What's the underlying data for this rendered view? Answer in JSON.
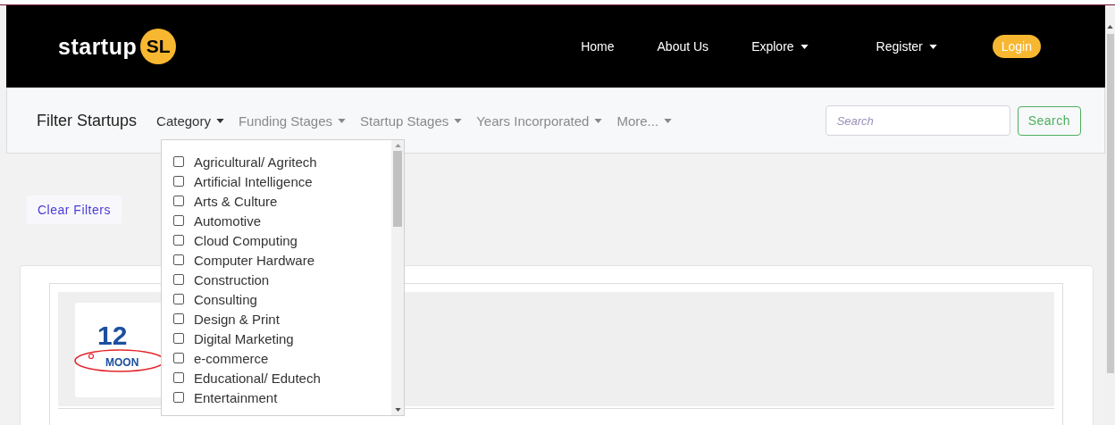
{
  "navbar": {
    "logo": {
      "text": "startup",
      "mark": "SL"
    },
    "items": [
      {
        "label": "Home",
        "kind": "link"
      },
      {
        "label": "About Us",
        "kind": "link"
      },
      {
        "label": "Explore",
        "kind": "dropdown"
      },
      {
        "label": "Register",
        "kind": "dropdown"
      },
      {
        "label": "Login",
        "kind": "button"
      }
    ]
  },
  "filter_bar": {
    "title": "Filter Startups",
    "menus": [
      {
        "label": "Category",
        "selected": true
      },
      {
        "label": "Funding Stages",
        "selected": false
      },
      {
        "label": "Startup Stages",
        "selected": false
      },
      {
        "label": "Years Incorporated",
        "selected": false
      },
      {
        "label": "More...",
        "selected": false
      }
    ],
    "search": {
      "placeholder": "Search"
    },
    "search_button": "Search"
  },
  "category_menu": {
    "items": [
      {
        "label": "Agricultural/ Agritech",
        "checked": false
      },
      {
        "label": "Artificial Intelligence",
        "checked": false
      },
      {
        "label": "Arts & Culture",
        "checked": false
      },
      {
        "label": "Automotive",
        "checked": false
      },
      {
        "label": "Cloud Computing",
        "checked": false
      },
      {
        "label": "Computer Hardware",
        "checked": false
      },
      {
        "label": "Construction",
        "checked": false
      },
      {
        "label": "Consulting",
        "checked": false
      },
      {
        "label": "Design & Print",
        "checked": false
      },
      {
        "label": "Digital Marketing",
        "checked": false
      },
      {
        "label": "e-commerce",
        "checked": false
      },
      {
        "label": "Educational/ Edutech",
        "checked": false
      },
      {
        "label": "Entertainment",
        "checked": false
      }
    ]
  },
  "clear_filters": "Clear Filters",
  "startup_card": {
    "logo": {
      "number": "12",
      "word": "MOON"
    }
  }
}
